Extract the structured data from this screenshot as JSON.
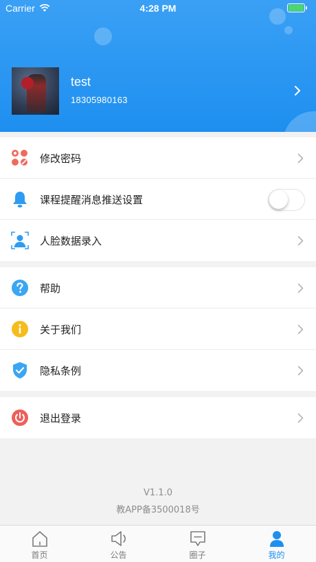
{
  "status_bar": {
    "carrier": "Carrier",
    "time": "4:28 PM"
  },
  "profile": {
    "name": "test",
    "phone": "18305980163"
  },
  "menu_group1": [
    {
      "label": "修改密码",
      "icon": "grid-edit-icon"
    },
    {
      "label": "课程提醒消息推送设置",
      "icon": "bell-icon",
      "toggle_on": false
    },
    {
      "label": "人脸数据录入",
      "icon": "face-scan-icon"
    }
  ],
  "menu_group2": [
    {
      "label": "帮助",
      "icon": "question-icon"
    },
    {
      "label": "关于我们",
      "icon": "info-icon"
    },
    {
      "label": "隐私条例",
      "icon": "shield-check-icon"
    }
  ],
  "menu_group3": [
    {
      "label": "退出登录",
      "icon": "power-icon"
    }
  ],
  "footer": {
    "version": "V1.1.0",
    "record": "教APP备3500018号"
  },
  "tabs": [
    {
      "label": "首页",
      "icon": "home-icon",
      "active": false
    },
    {
      "label": "公告",
      "icon": "speaker-icon",
      "active": false
    },
    {
      "label": "圈子",
      "icon": "message-icon",
      "active": false
    },
    {
      "label": "我的",
      "icon": "person-icon",
      "active": true
    }
  ],
  "colors": {
    "primary": "#1e8ff0",
    "background": "#f2f2f2",
    "logout": "#ef5f5a"
  }
}
